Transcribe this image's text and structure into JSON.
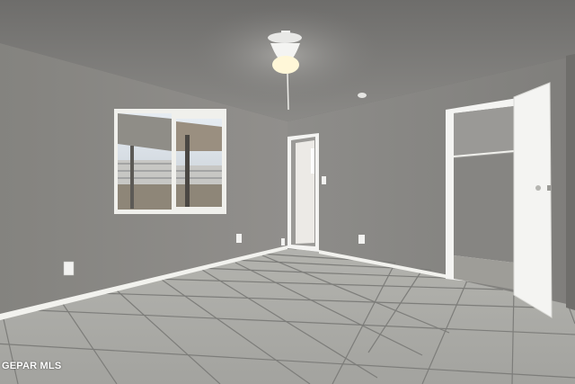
{
  "photo": {
    "subject": "empty-bedroom-interior",
    "watermark": "GEPAR MLS",
    "colors": {
      "wall": "#8a8986",
      "ceiling": "#7c7b79",
      "floor_tile": "#a9a9a5",
      "grout": "#7d7d7a",
      "baseboard": "#f2f2ee",
      "door": "#f4f4f2",
      "window_glass": "#cfd6dc"
    }
  }
}
